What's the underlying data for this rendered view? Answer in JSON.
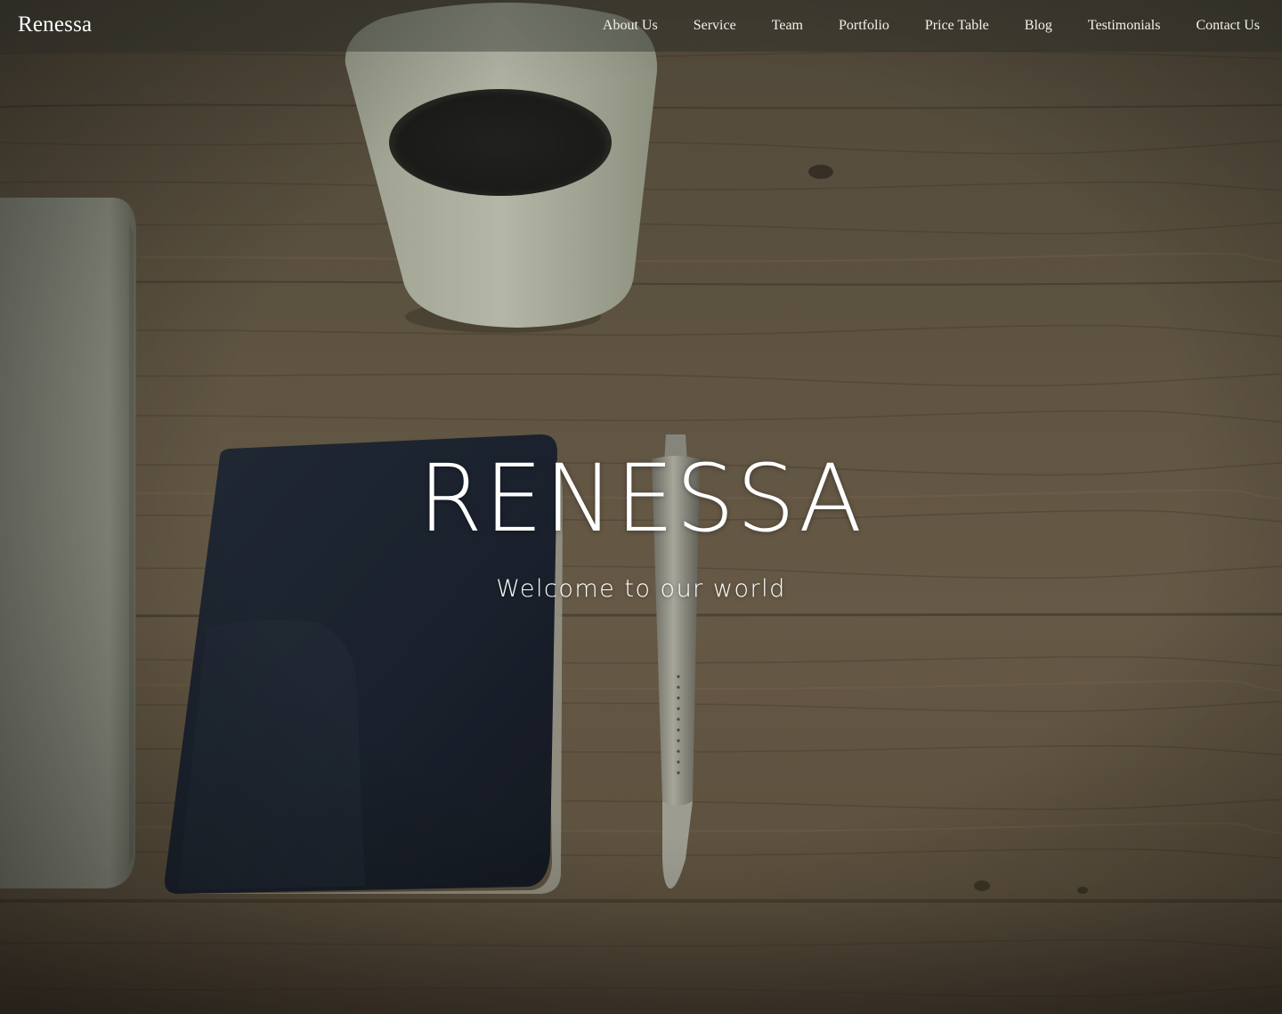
{
  "navbar": {
    "brand": "Renessa",
    "links": [
      {
        "label": "About Us"
      },
      {
        "label": "Service"
      },
      {
        "label": "Team"
      },
      {
        "label": "Portfolio"
      },
      {
        "label": "Price Table"
      },
      {
        "label": "Blog"
      },
      {
        "label": "Testimonials"
      },
      {
        "label": "Contact Us"
      }
    ]
  },
  "hero": {
    "title": "RENESSA",
    "subtitle": "Welcome to our world",
    "background": "wooden-desk-coffee-notebook-pen-laptop-photo"
  },
  "colors": {
    "nav_text": "#f4f1ea",
    "title_text": "#ffffff",
    "wood_light": "#8a7358",
    "wood_dark": "#4e3f31",
    "notebook": "#1e2532"
  }
}
